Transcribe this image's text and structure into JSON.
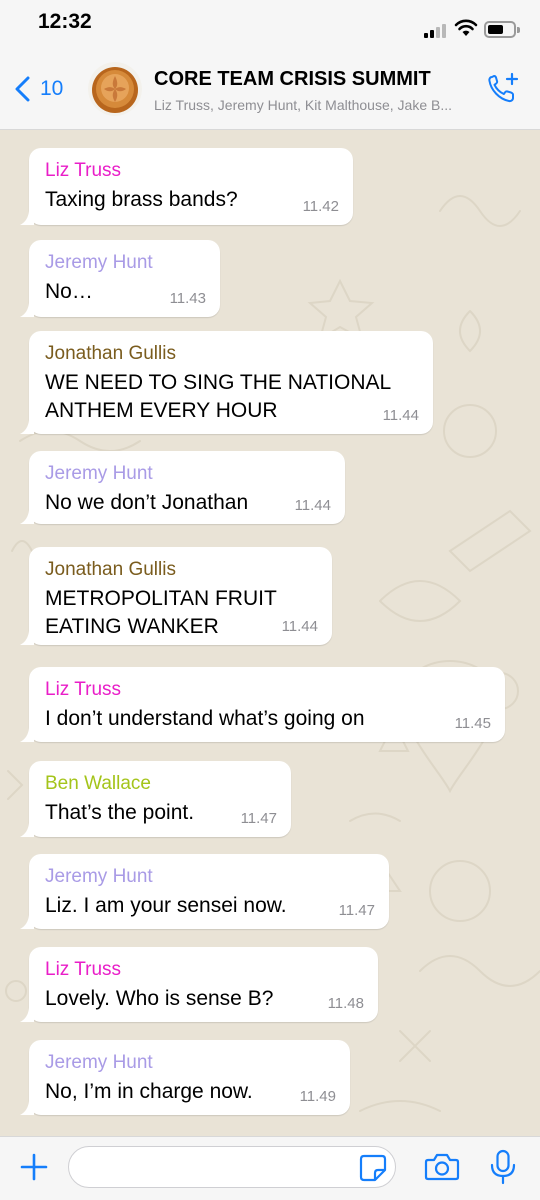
{
  "status_bar": {
    "time": "12:32"
  },
  "header": {
    "back_count": "10",
    "title": "CORE TEAM CRISIS SUMMIT",
    "members": "Liz Truss, Jeremy Hunt, Kit Malthouse, Jake B..."
  },
  "messages": [
    {
      "sender": "Liz Truss",
      "sender_color": "#e91ec8",
      "text": [
        "Taxing brass bands?"
      ],
      "time": "11.42"
    },
    {
      "sender": "Jeremy Hunt",
      "sender_color": "#a99be6",
      "text": [
        "No…"
      ],
      "time": "11.43"
    },
    {
      "sender": "Jonathan Gullis",
      "sender_color": "#7a5c1e",
      "text": [
        "WE NEED TO SING THE NATIONAL",
        "ANTHEM EVERY HOUR"
      ],
      "time": "11.44"
    },
    {
      "sender": "Jeremy Hunt",
      "sender_color": "#a99be6",
      "text": [
        "No we don’t Jonathan"
      ],
      "time": "11.44"
    },
    {
      "sender": "Jonathan Gullis",
      "sender_color": "#7a5c1e",
      "text": [
        "METROPOLITAN FRUIT",
        "EATING WANKER"
      ],
      "time": "11.44"
    },
    {
      "sender": "Liz Truss",
      "sender_color": "#e91ec8",
      "text": [
        "I don’t understand what’s going on"
      ],
      "time": "11.45"
    },
    {
      "sender": "Ben Wallace",
      "sender_color": "#a4c41a",
      "text": [
        "That’s the point."
      ],
      "time": "11.47"
    },
    {
      "sender": "Jeremy Hunt",
      "sender_color": "#a99be6",
      "text": [
        "Liz. I am your sensei now."
      ],
      "time": "11.47"
    },
    {
      "sender": "Liz Truss",
      "sender_color": "#e91ec8",
      "text": [
        "Lovely. Who is sense B?"
      ],
      "time": "11.48"
    },
    {
      "sender": "Jeremy Hunt",
      "sender_color": "#a99be6",
      "text": [
        "No, I’m in charge now."
      ],
      "time": "11.49"
    }
  ],
  "input": {
    "value": "",
    "placeholder": ""
  },
  "icons": {
    "back": "chevron-left-icon",
    "call": "add-call-icon",
    "attach": "plus-icon",
    "sticker": "sticker-icon",
    "camera": "camera-icon",
    "mic": "microphone-icon"
  },
  "colors": {
    "accent": "#157efb",
    "bubble": "#ffffff",
    "wallpaper": "#e9e3d6"
  }
}
